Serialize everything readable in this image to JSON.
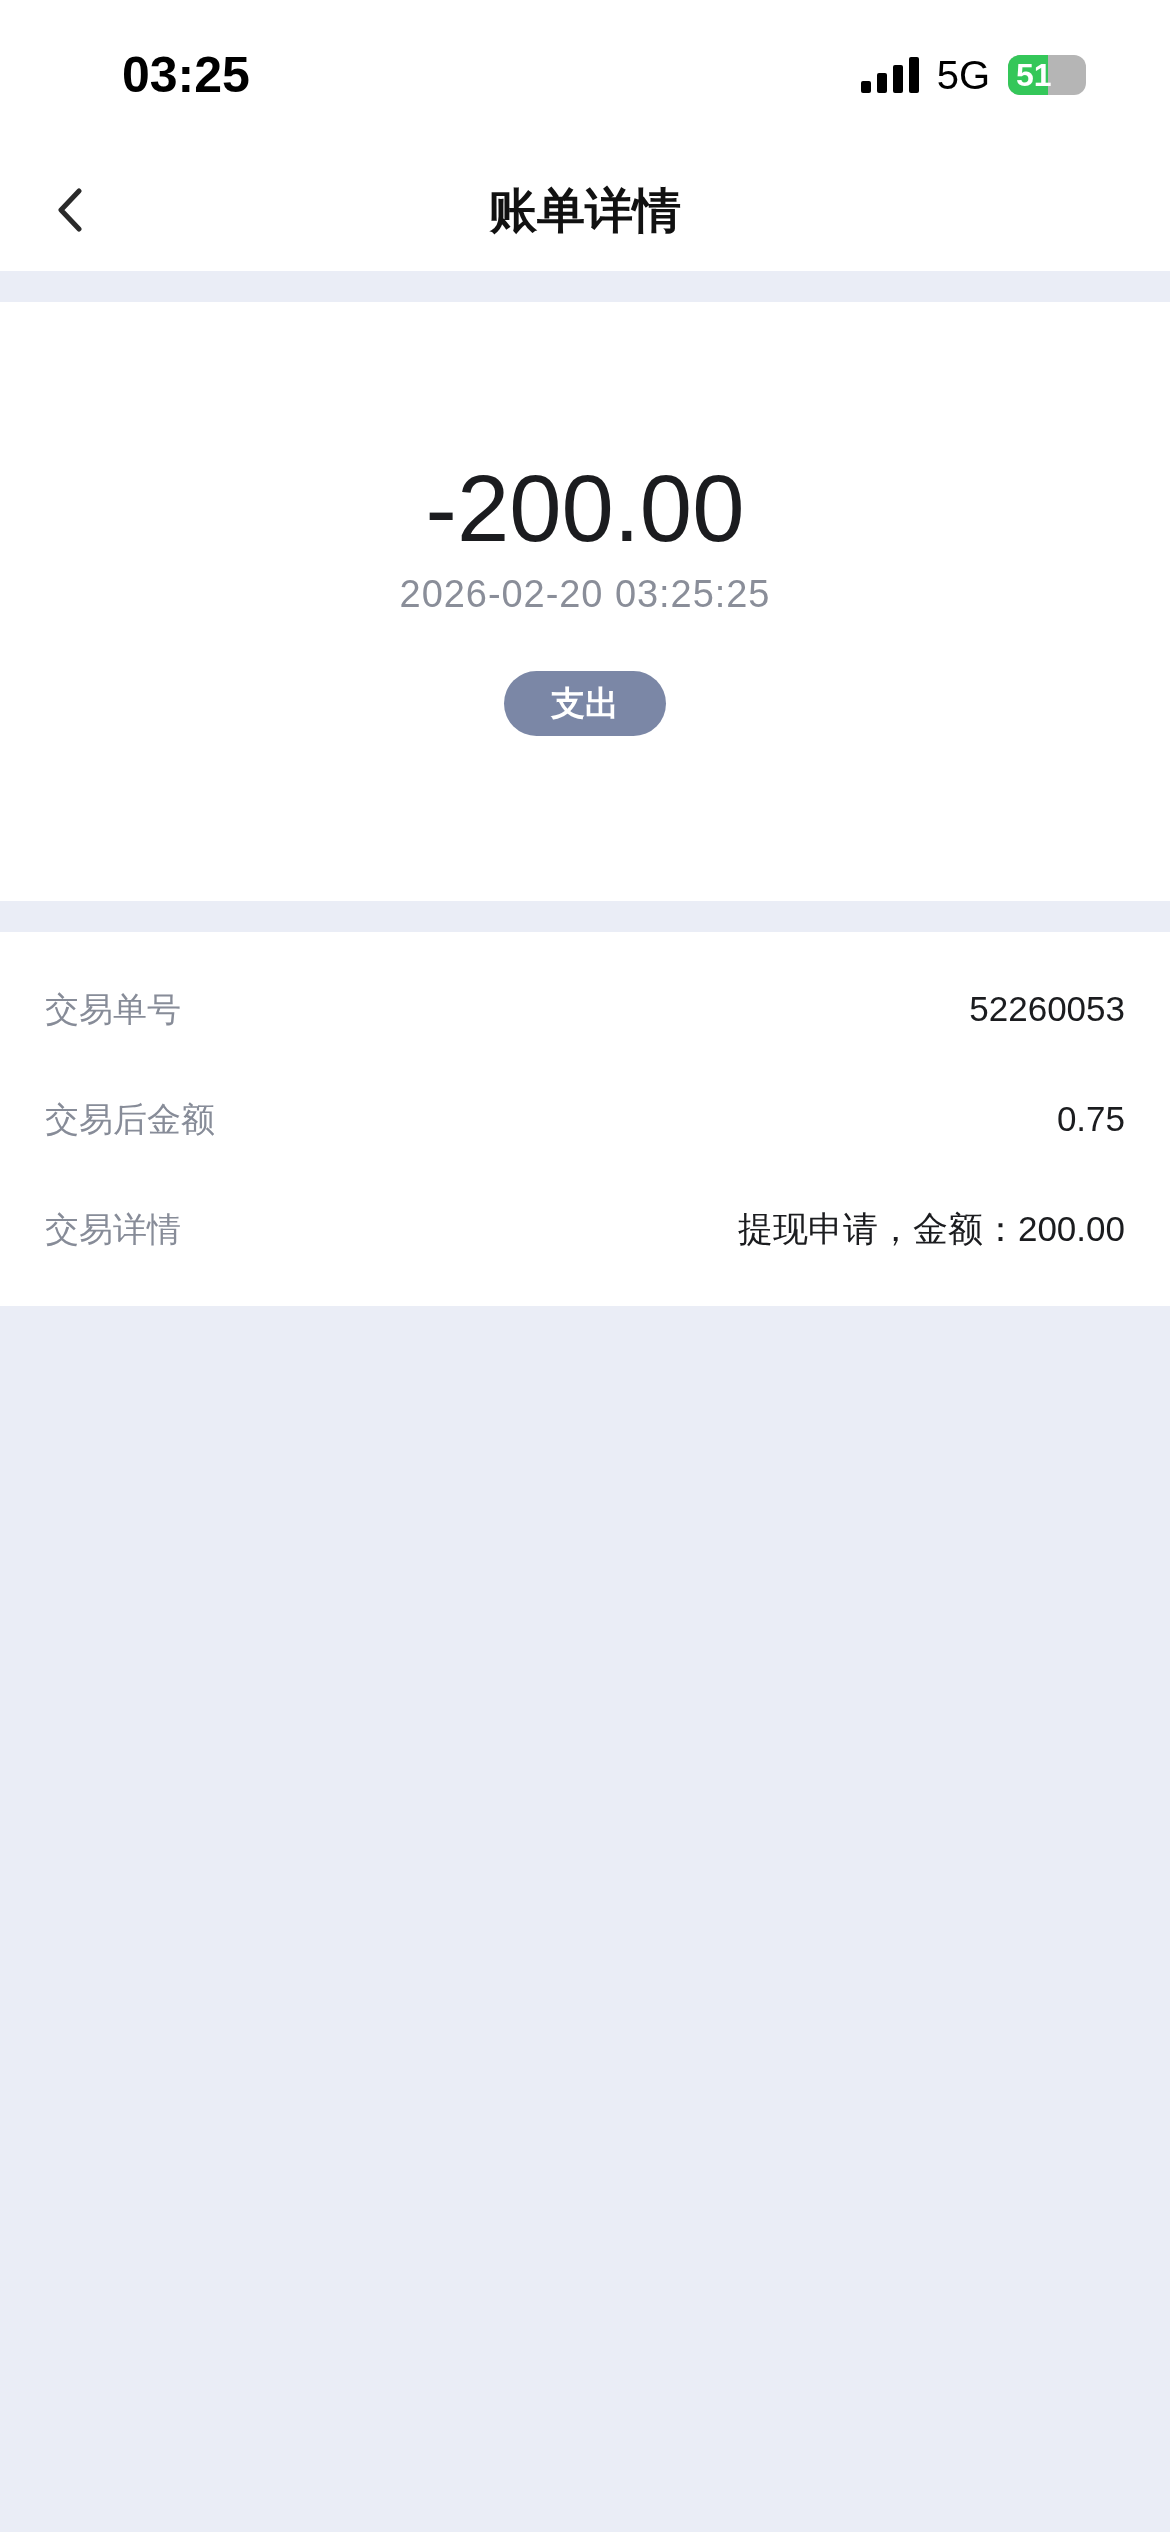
{
  "status_bar": {
    "time": "03:25",
    "network": "5G",
    "battery": "51"
  },
  "nav": {
    "title": "账单详情"
  },
  "summary": {
    "amount": "-200.00",
    "datetime": "2026-02-20 03:25:25",
    "type_badge": "支出"
  },
  "details": [
    {
      "label": "交易单号",
      "value": "52260053"
    },
    {
      "label": "交易后金额",
      "value": "0.75"
    },
    {
      "label": "交易详情",
      "value": "提现申请，金额：200.00"
    }
  ]
}
